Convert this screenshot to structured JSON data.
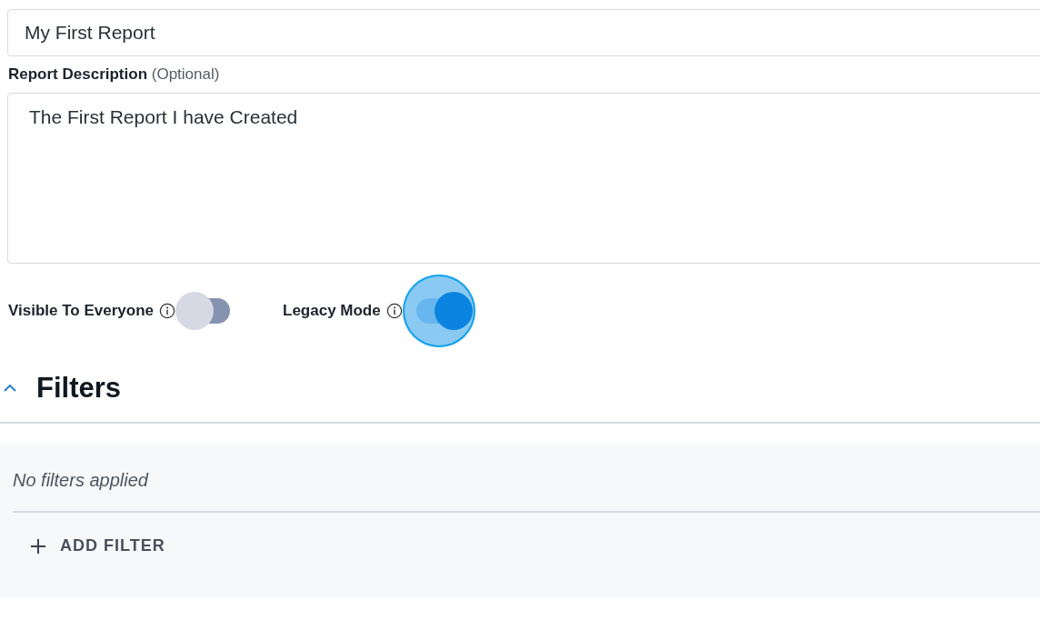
{
  "report_name": {
    "value": "My First Report"
  },
  "report_description": {
    "label": "**Report Description** (Optional)",
    "value": "The First Report I have Created"
  },
  "toggles": [
    {
      "label": "Visible To Everyone",
      "on": false,
      "focused": false
    },
    {
      "label": "Legacy Mode",
      "on": true,
      "focused": true
    }
  ],
  "filters": {
    "title": "Filters",
    "expanded": true,
    "empty_text": "No filters applied",
    "add_button": "ADD FILTER"
  }
}
